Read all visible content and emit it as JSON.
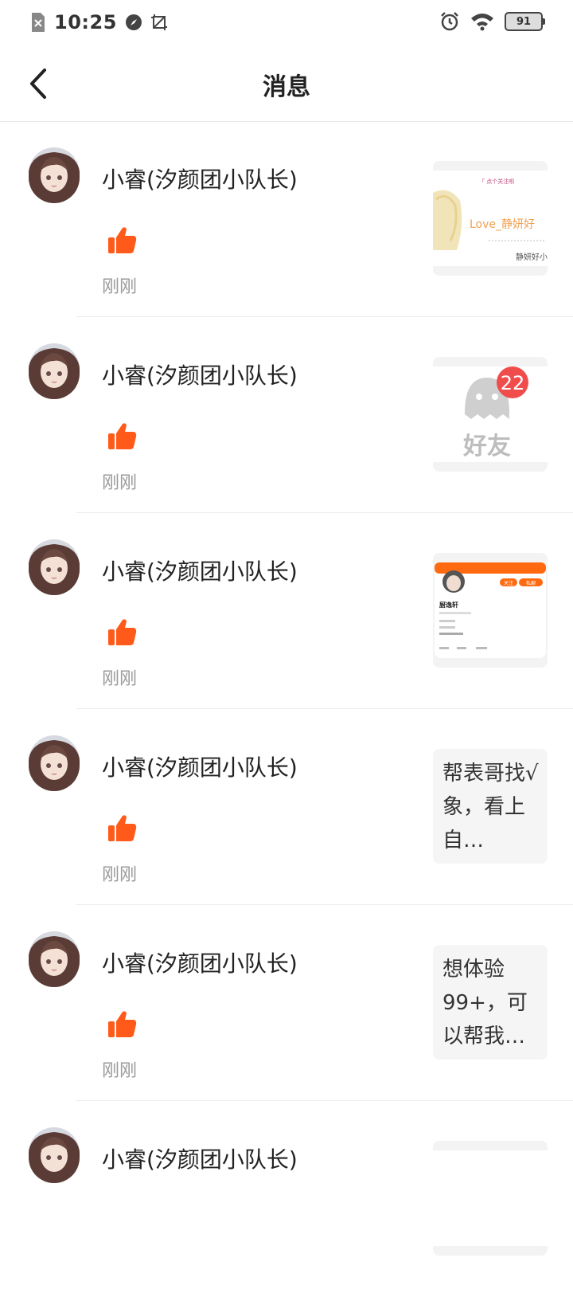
{
  "status_bar": {
    "time": "10:25",
    "battery": "91"
  },
  "header": {
    "title": "消息"
  },
  "messages": [
    {
      "name": "小睿(汐颜团小队长)",
      "time": "刚刚",
      "thumb_type": "image-banner",
      "thumb_lines": [
        "「 点个关注呗",
        "Love_静妍好",
        "静妍好小"
      ]
    },
    {
      "name": "小睿(汐颜团小队长)",
      "time": "刚刚",
      "thumb_type": "friends",
      "thumb_label": "好友",
      "badge": "22"
    },
    {
      "name": "小睿(汐颜团小队长)",
      "time": "刚刚",
      "thumb_type": "profile-card",
      "thumb_name": "厨逸轩",
      "thumb_btn1": "关注",
      "thumb_btn2": "私聊"
    },
    {
      "name": "小睿(汐颜团小队长)",
      "time": "刚刚",
      "thumb_type": "text",
      "thumb_text": "帮表哥找√象，看上自…"
    },
    {
      "name": "小睿(汐颜团小队长)",
      "time": "刚刚",
      "thumb_type": "text",
      "thumb_text": "想体验99+，可以帮我…"
    },
    {
      "name": "小睿(汐颜团小队长)",
      "time": "",
      "thumb_type": "image-banner",
      "thumb_lines": [
        "",
        "",
        ""
      ]
    }
  ],
  "colors": {
    "accent": "#ff5a1a",
    "badge": "#f04c4c"
  }
}
